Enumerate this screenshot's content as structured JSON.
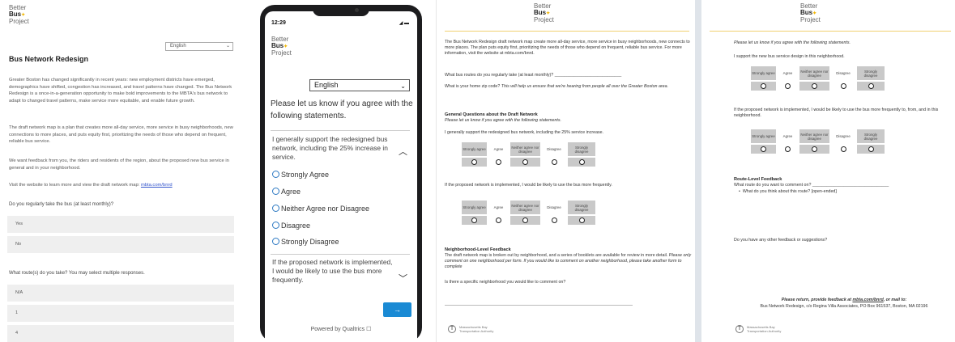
{
  "logo": {
    "line1": "Better",
    "line2": "Bus",
    "line3": "Project"
  },
  "web": {
    "language": "English",
    "title": "Bus Network Redesign",
    "p1": "Greater Boston has changed significantly in recent years: new employment districts have emerged, demographics have shifted, congestion has increased, and travel patterns have changed. The Bus Network Redesign is a once-in-a-generation opportunity to make bold improvements to the MBTA's bus network to adapt to changed travel patterns, make service more equitable, and enable future growth.",
    "p2": "The draft network map is a plan that creates more all-day service, more service in busy neighborhoods, new connections to more places, and puts equity first, prioritizing the needs of those who depend on frequent, reliable bus service.",
    "p3": "We want feedback from you, the riders and residents of the region, about the proposed new bus service in general and in your neighborhood.",
    "p4_prefix": "Visit the website to learn more and view the draft network map: ",
    "p4_link": "mbta.com/bnrd",
    "q1": "Do you regularly take the bus (at least monthly)?",
    "q1_options": [
      "Yes",
      "No"
    ],
    "q2": "What route(s) do you take? You may select multiple responses.",
    "q2_options": [
      "N/A",
      "1",
      "4"
    ]
  },
  "phone": {
    "time": "12:29",
    "signal": "◢ ▬",
    "language": "English",
    "intro": "Please let us know if you agree with the following statements.",
    "statement1": "I generally support the redesigned bus network, including the 25% increase in service.",
    "options": [
      "Strongly Agree",
      "Agree",
      "Neither Agree nor Disagree",
      "Disagree",
      "Strongly Disagree"
    ],
    "statement2": "If the proposed network is implemented, I would be likely to use the bus more frequently.",
    "next_label": "→",
    "powered": "Powered by Qualtrics ☐"
  },
  "scale_labels": [
    "Strongly agree",
    "Agree",
    "Neither agree nor disagree",
    "Disagree",
    "Strongly disagree"
  ],
  "paper1": {
    "intro": "The Bus Network Redesign draft network map create more all-day service, more service in busy neighborhoods, new connects to more places. The plan puts equity first, prioritizing the needs of those who depend on frequent, reliable bus service. For more information, visit the website at mbta.com/bnrd.",
    "q_routes": "What bus routes do you regularly take (at least monthly)?",
    "q_zip": "What is your home zip code?",
    "q_zip_note": "This will help us ensure that we're hearing from people all over the Greater Boston area.",
    "section1_title": "General Questions about the Draft Network",
    "section1_note": "Please let us know if you agree with the following statements.",
    "s1": "I generally support the redesigned bus network, including the 25% service increase.",
    "s2": "If the proposed network is implemented, I would be likely to use the bus more frequently.",
    "section2_title": "Neighborhood-Level Feedback",
    "section2_body": "The draft network map is broken out by neighborhood, and a series of booklets are available for review in more detail.",
    "section2_note": "Please only comment on one neighborhood per form. If you would like to comment on another neighborhood, please take another form to complete",
    "q_neighborhood": "Is there a specific neighborhood you would like to comment on?",
    "mbta_line1": "Massachusetts Bay",
    "mbta_line2": "Transportation Authority"
  },
  "paper2": {
    "intro": "Please let us know if you agree with the following statements.",
    "s1": "I support the new bus service design in this neighborhood.",
    "s2": "If the proposed network is implemented, I would be likely to use the bus more frequently to, from, and in this neighborhood.",
    "route_title": "Route-Level Feedback",
    "route_q": "What route do you want to comment on?",
    "route_bullet": "What do you think about this route? [open-ended]",
    "other_q": "Do you have any other feedback or suggestions?",
    "return_prefix": "Please return, provide feedback at ",
    "return_link": "mbta.com/bnrd",
    "return_suffix": ", or mail to:",
    "address": "Bus Network Redesign, c/o Regina Villa Associates, PO Box 961537, Boston, MA 02196",
    "mbta_line1": "Massachusetts Bay",
    "mbta_line2": "Transportation Authority"
  }
}
